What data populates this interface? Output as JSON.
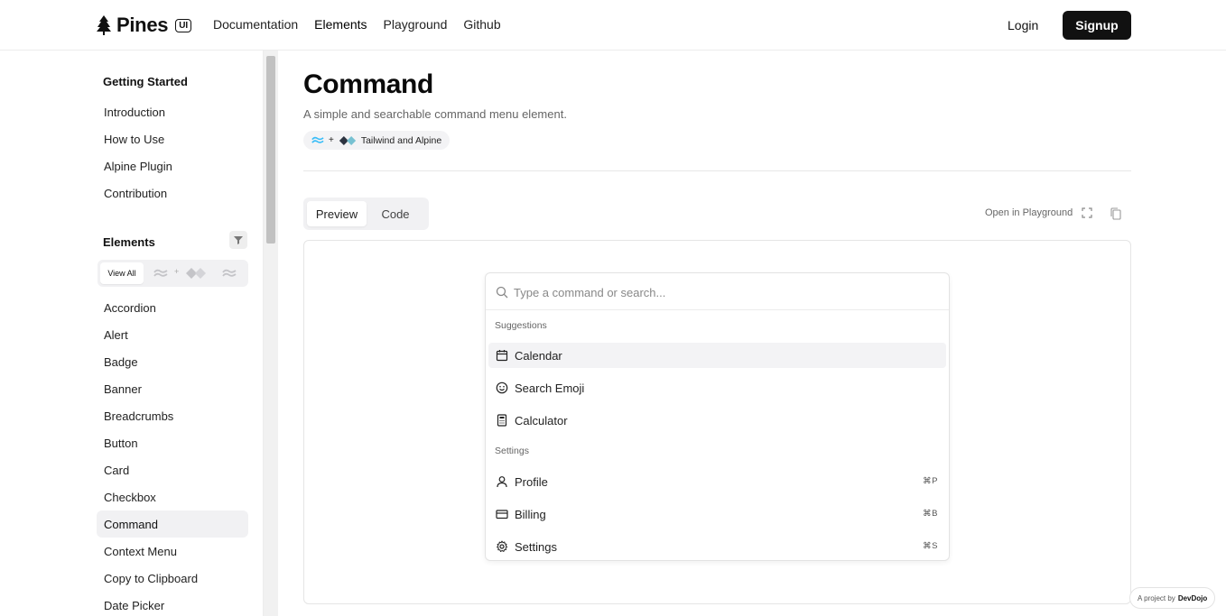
{
  "header": {
    "logo_text": "Pines",
    "logo_badge": "UI",
    "nav": [
      "Documentation",
      "Elements",
      "Playground",
      "Github"
    ],
    "login_label": "Login",
    "signup_label": "Signup"
  },
  "sidebar": {
    "getting_started_title": "Getting Started",
    "getting_started_items": [
      "Introduction",
      "How to Use",
      "Alpine Plugin",
      "Contribution"
    ],
    "elements_title": "Elements",
    "view_all_label": "View All",
    "tech_plus": "+",
    "element_items": [
      "Accordion",
      "Alert",
      "Badge",
      "Banner",
      "Breadcrumbs",
      "Button",
      "Card",
      "Checkbox",
      "Command",
      "Context Menu",
      "Copy to Clipboard",
      "Date Picker"
    ],
    "active_item": "Command"
  },
  "main": {
    "title": "Command",
    "description": "A simple and searchable command menu element.",
    "badge_plus": "+",
    "badge_text": "Tailwind and Alpine",
    "tabs": [
      "Preview",
      "Code"
    ],
    "open_playground_label": "Open in Playground"
  },
  "command": {
    "placeholder": "Type a command or search...",
    "group_suggestions": "Suggestions",
    "suggestions": [
      {
        "label": "Calendar",
        "icon": "calendar-icon"
      },
      {
        "label": "Search Emoji",
        "icon": "smiley-icon"
      },
      {
        "label": "Calculator",
        "icon": "calculator-icon"
      }
    ],
    "group_settings": "Settings",
    "settings": [
      {
        "label": "Profile",
        "icon": "user-icon",
        "shortcut": "⌘P"
      },
      {
        "label": "Billing",
        "icon": "credit-card-icon",
        "shortcut": "⌘B"
      },
      {
        "label": "Settings",
        "icon": "gear-icon",
        "shortcut": "⌘S"
      }
    ]
  },
  "footer": {
    "prefix": "A project by",
    "brand": "DevDojo"
  },
  "colors": {
    "accent": "#111111",
    "tailwind": "#38bdf8",
    "alpine_dark": "#2d3441",
    "alpine_light": "#77c1d2"
  }
}
